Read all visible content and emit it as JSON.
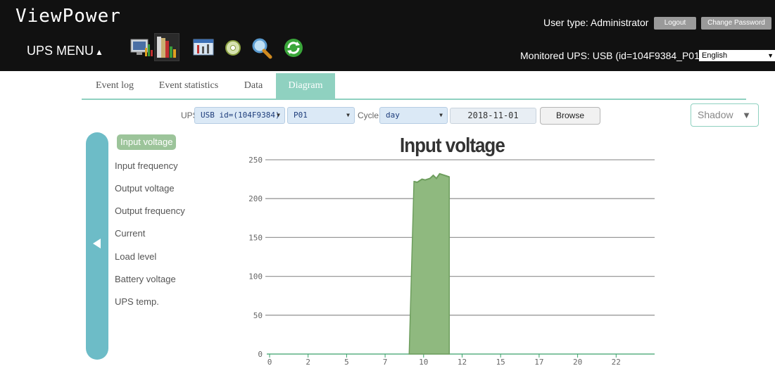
{
  "header": {
    "app_title": "ViewPower",
    "ups_menu_label": "UPS MENU",
    "user_type": "User type: Administrator",
    "logout_label": "Logout",
    "change_password_label": "Change Password",
    "monitored_ups": "Monitored UPS: USB (id=104F9384_P01)",
    "language": "English",
    "toolbar_icons": [
      "monitor-chart-icon",
      "data-books-icon",
      "control-panel-icon",
      "disc-icon",
      "magnifier-icon",
      "refresh-icon"
    ]
  },
  "tabs": [
    {
      "label": "Event log",
      "active": false
    },
    {
      "label": "Event statistics",
      "active": false
    },
    {
      "label": "Data",
      "active": false
    },
    {
      "label": "Diagram",
      "active": true
    }
  ],
  "filters": {
    "ups_label": "UPS",
    "ups_value": "USB id=(104F9384)",
    "port_value": "P01",
    "cycle_label": "Cycle",
    "cycle_value": "day",
    "date_value": "2018-11-01",
    "browse_label": "Browse",
    "shadow_value": "Shadow"
  },
  "sidebar": {
    "items": [
      {
        "label": "Input voltage",
        "active": true
      },
      {
        "label": "Input frequency",
        "active": false
      },
      {
        "label": "Output voltage",
        "active": false
      },
      {
        "label": "Output frequency",
        "active": false
      },
      {
        "label": "Current",
        "active": false
      },
      {
        "label": "Load level",
        "active": false
      },
      {
        "label": "Battery voltage",
        "active": false
      },
      {
        "label": "UPS temp.",
        "active": false
      }
    ]
  },
  "colors": {
    "header_bg": "#111111",
    "accent": "#8fd1c0",
    "sidebar_bar": "#6dbcc7",
    "series_fill": "#8fb97f",
    "series_stroke": "#6e9e5e"
  },
  "chart_data": {
    "type": "area",
    "title": "Input voltage",
    "xlabel": "",
    "ylabel": "",
    "xlim": [
      0,
      24
    ],
    "ylim": [
      0,
      250
    ],
    "yticks": [
      0,
      50,
      100,
      150,
      200,
      250
    ],
    "xtick_labels": [
      "0",
      "2",
      "5",
      "7",
      "10",
      "12",
      "15",
      "17",
      "20",
      "22"
    ],
    "xtick_values": [
      0,
      2.4,
      4.8,
      7.2,
      9.6,
      12,
      14.4,
      16.8,
      19.2,
      21.6
    ],
    "grid": true,
    "legend": "none",
    "series": [
      {
        "x": [
          8.7,
          9.0,
          9.2,
          9.5,
          9.7,
          10.0,
          10.2,
          10.4,
          10.6,
          10.9,
          11.2,
          11.2
        ],
        "y": [
          0,
          222,
          221,
          225,
          224,
          226,
          230,
          226,
          232,
          230,
          228,
          0
        ]
      }
    ]
  }
}
